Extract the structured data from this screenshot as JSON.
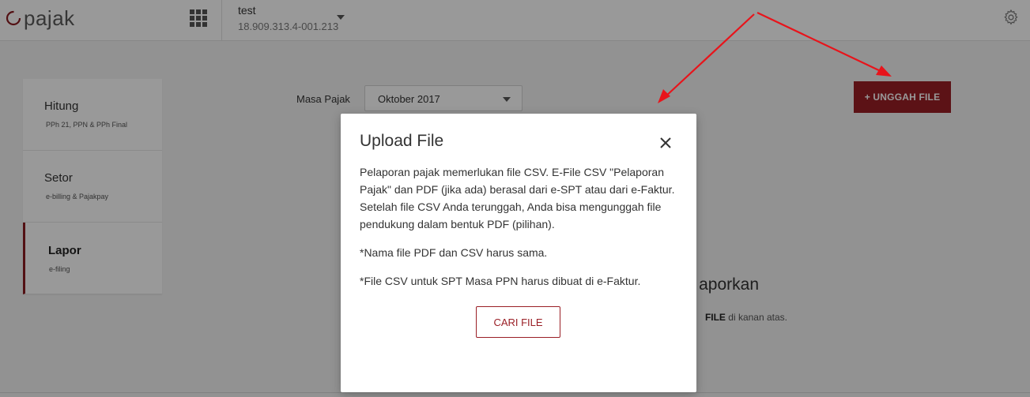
{
  "header": {
    "logo_text": "pajak",
    "company_name": "test",
    "company_npwp": "18.909.313.4-001.213"
  },
  "sidebar": {
    "items": [
      {
        "title": "Hitung",
        "subtitle": "PPh 21, PPN & PPh Final"
      },
      {
        "title": "Setor",
        "subtitle": "e-billing & Pajakpay"
      },
      {
        "title": "Lapor",
        "subtitle": "e-filing"
      }
    ]
  },
  "main": {
    "masa_label": "Masa Pajak",
    "masa_value": "Oktober 2017",
    "upload_button": "+ UNGGAH FILE",
    "empty_title_visible": "aporkan",
    "empty_hint_bold": "FILE",
    "empty_hint_rest": " di kanan atas."
  },
  "modal": {
    "title": "Upload File",
    "paragraphs": [
      "Pelaporan pajak memerlukan file CSV. E-File CSV \"Pelaporan Pajak\" dan PDF (jika ada) berasal dari e-SPT atau dari e-Faktur. Setelah file CSV Anda terunggah, Anda bisa mengunggah file pendukung dalam bentuk PDF (pilihan).",
      "*Nama file PDF dan CSV harus sama.",
      "*File CSV untuk SPT Masa PPN harus dibuat di e-Faktur."
    ],
    "button": "CARI FILE"
  },
  "colors": {
    "brand": "#9a1f26",
    "annotation": "#e8141b"
  },
  "icons": {
    "apps": "grid-apps-icon",
    "company_menu": "caret-down-icon",
    "settings": "gear-icon",
    "close": "close-icon"
  }
}
